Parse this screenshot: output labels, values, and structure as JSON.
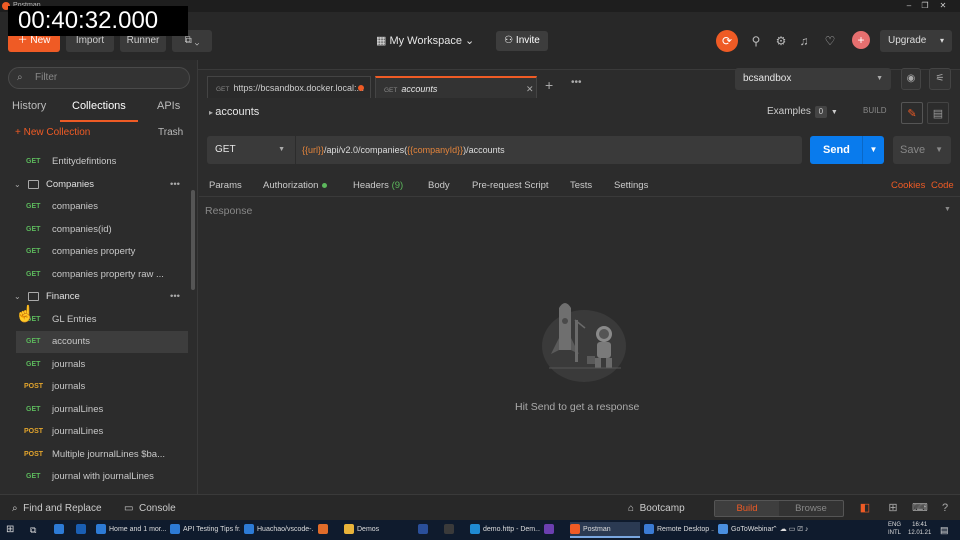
{
  "overlay": {
    "timer": "00:40:32.000"
  },
  "titlebar": {
    "app_name": "Postman",
    "minimize": "–",
    "maximize": "❐",
    "close": "✕"
  },
  "header": {
    "new_label": "New",
    "import_label": "Import",
    "runner_label": "Runner",
    "workspace_label": "My Workspace",
    "invite_label": "Invite",
    "upgrade_label": "Upgrade",
    "accent_color": "#ef5b25"
  },
  "sidebar": {
    "filter_placeholder": "Filter",
    "tabs": [
      "History",
      "Collections",
      "APIs"
    ],
    "active_tab": "Collections",
    "new_collection_label": "+ New Collection",
    "trash_label": "Trash",
    "items": [
      {
        "type": "request",
        "method": "GET",
        "label": "Entitydefintions"
      },
      {
        "type": "folder",
        "label": "Companies",
        "expanded": true
      },
      {
        "type": "request",
        "method": "GET",
        "label": "companies"
      },
      {
        "type": "request",
        "method": "GET",
        "label": "companies(id)"
      },
      {
        "type": "request",
        "method": "GET",
        "label": "companies property"
      },
      {
        "type": "request",
        "method": "GET",
        "label": "companies property raw ..."
      },
      {
        "type": "folder",
        "label": "Finance",
        "expanded": true
      },
      {
        "type": "request",
        "method": "GET",
        "label": "GL Entries"
      },
      {
        "type": "request",
        "method": "GET",
        "label": "accounts",
        "selected": true
      },
      {
        "type": "request",
        "method": "GET",
        "label": "journals"
      },
      {
        "type": "request",
        "method": "POST",
        "label": "journals"
      },
      {
        "type": "request",
        "method": "GET",
        "label": "journalLines"
      },
      {
        "type": "request",
        "method": "POST",
        "label": "journalLines"
      },
      {
        "type": "request",
        "method": "POST",
        "label": "Multiple journalLines $ba..."
      },
      {
        "type": "request",
        "method": "GET",
        "label": "journal with journalLines"
      }
    ]
  },
  "request_tabs": [
    {
      "method": "GET",
      "label": "https://bcsandbox.docker.local:...",
      "unsaved": true
    },
    {
      "method": "GET",
      "label": "accounts",
      "active": true
    }
  ],
  "environment": {
    "selected": "bcsandbox"
  },
  "request": {
    "name": "accounts",
    "examples_label": "Examples",
    "examples_count": "0",
    "build_label": "BUILD",
    "method": "GET",
    "url_parts": [
      {
        "text": "{{url}}",
        "var": true
      },
      {
        "text": "/api/v2.0/companies(",
        "var": false
      },
      {
        "text": "{{companyId}}",
        "var": true
      },
      {
        "text": ")/accounts",
        "var": false
      }
    ],
    "send_label": "Send",
    "save_label": "Save",
    "param_tabs": [
      "Params",
      "Authorization",
      "Headers",
      "Body",
      "Pre-request Script",
      "Tests",
      "Settings"
    ],
    "headers_count": "(9)",
    "cookies_label": "Cookies",
    "code_label": "Code"
  },
  "response": {
    "label": "Response",
    "hint": "Hit Send to get a response"
  },
  "footer": {
    "find_replace": "Find and Replace",
    "console": "Console",
    "bootcamp": "Bootcamp",
    "build": "Build",
    "browse": "Browse"
  },
  "taskbar": {
    "items": [
      {
        "label": "Home and 1 mor...",
        "color": "#2d7bd6"
      },
      {
        "label": "API Testing Tips fr...",
        "color": "#2d7bd6"
      },
      {
        "label": "Huachao/vscode-...",
        "color": "#2d7bd6"
      },
      {
        "label": "",
        "color": "#e06c2a"
      },
      {
        "label": "Demos",
        "color": "#e8b33a"
      },
      {
        "label": "",
        "color": "#2a4f9a"
      },
      {
        "label": "",
        "color": "#3a3a3a"
      },
      {
        "label": "demo.http - Dem...",
        "color": "#1f8ad2"
      },
      {
        "label": "",
        "color": "#6b3fb0"
      },
      {
        "label": "Postman",
        "color": "#ef5b25",
        "active": true
      },
      {
        "label": "Remote Desktop ...",
        "color": "#3b7bd4"
      },
      {
        "label": "GoToWebinar",
        "color": "#4a8fe0"
      }
    ],
    "lang": "ENG",
    "layout": "INTL",
    "time": "16:41",
    "date": "12.01.21"
  }
}
